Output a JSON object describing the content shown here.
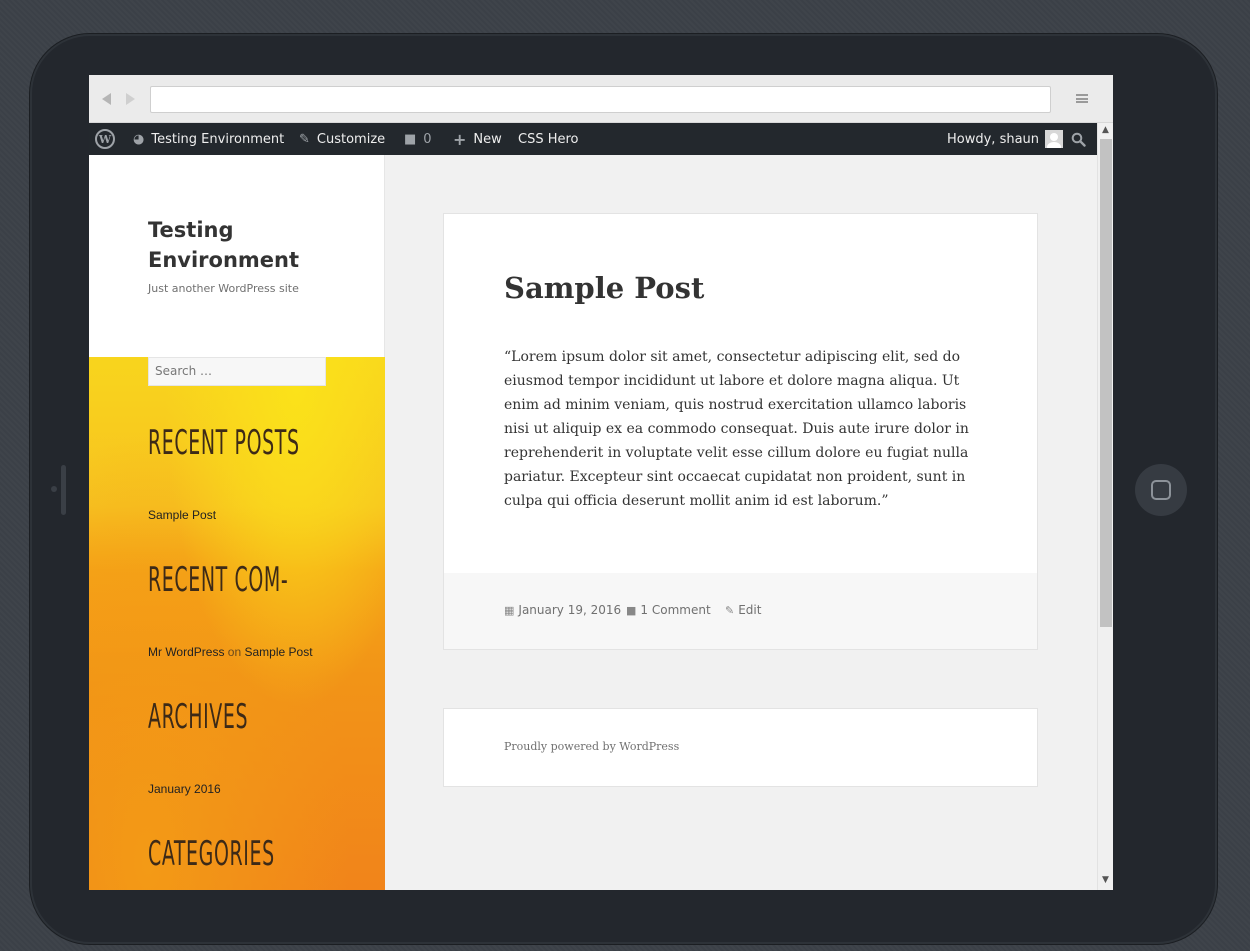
{
  "adminbar": {
    "site_name": "Testing Environment",
    "customize": "Customize",
    "comments_count": "0",
    "new": "New",
    "css_hero": "CSS Hero",
    "howdy": "Howdy, shaun"
  },
  "site": {
    "title": "Testing Environment",
    "description": "Just another WordPress site"
  },
  "search": {
    "placeholder": "Search …"
  },
  "widgets": {
    "recent_posts": {
      "title": "RECENT POSTS",
      "items": [
        "Sample Post"
      ]
    },
    "recent_comments": {
      "title": "RECENT COM-",
      "author": "Mr WordPress",
      "on": "on",
      "post": "Sample Post"
    },
    "archives": {
      "title": "ARCHIVES",
      "items": [
        "January 2016"
      ]
    },
    "categories": {
      "title": "CATEGORIES"
    }
  },
  "post": {
    "title": "Sample Post",
    "body": "“Lorem ipsum dolor sit amet, consectetur adipiscing elit, sed do eiusmod tempor incididunt ut labore et dolore magna aliqua. Ut enim ad minim veniam, quis nostrud exercitation ullamco laboris nisi ut aliquip ex ea commodo consequat. Duis aute irure dolor in reprehenderit in voluptate velit esse cillum dolore eu fugiat nulla pariatur. Excepteur sint occaecat cupidatat non proident, sunt in culpa qui officia deserunt mollit anim id est laborum.”",
    "date": "January 19, 2016",
    "comments": "1 Comment",
    "edit": "Edit"
  },
  "footer": {
    "text": "Proudly powered by WordPress"
  },
  "colors": {
    "admin_bar": "#23282d",
    "sidebar_orange": "#f29417",
    "sidebar_yellow": "#f8d51d"
  }
}
